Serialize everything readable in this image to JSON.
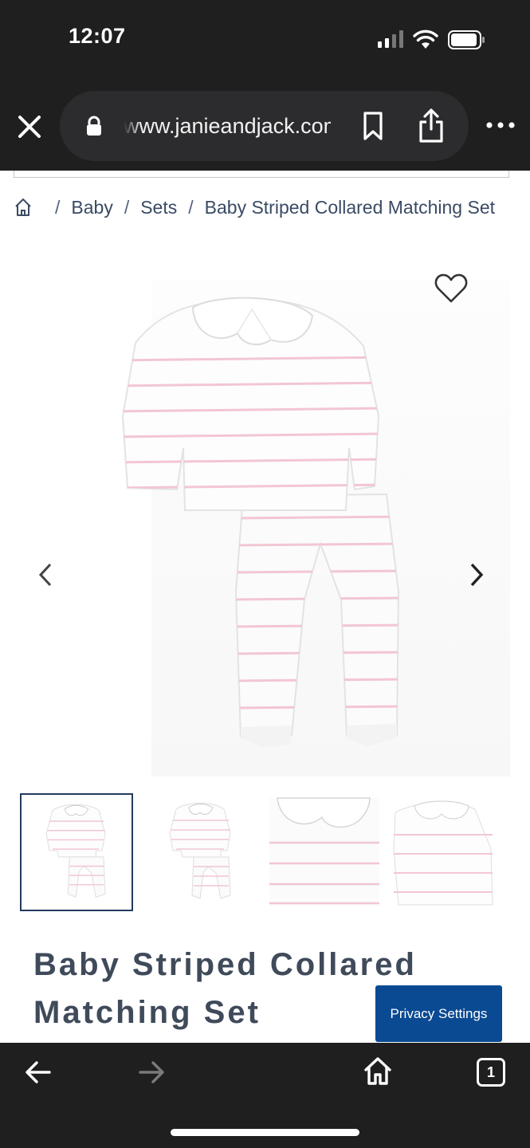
{
  "status_bar": {
    "time": "12:07",
    "icons": [
      "signal-icon",
      "wifi-icon",
      "battery-icon"
    ]
  },
  "browser": {
    "url": "www.janieandjack.com",
    "icons": [
      "close-icon",
      "lock-icon",
      "bookmark-icon",
      "share-icon",
      "more-icon"
    ]
  },
  "breadcrumb": {
    "home_icon": "home-icon",
    "items": [
      "Baby",
      "Sets",
      "Baby Striped Collared Matching Set"
    ],
    "separator": "/"
  },
  "product": {
    "title_line1": "Baby Striped Collared",
    "title_line2": "Matching Set",
    "favorite_icon": "heart-icon",
    "gallery": {
      "prev_icon": "chevron-left-icon",
      "next_icon": "chevron-right-icon",
      "thumbnails": [
        "front-view",
        "back-view",
        "collar-detail",
        "sweater-detail"
      ],
      "active_thumbnail": 1
    }
  },
  "privacy": {
    "label": "Privacy Settings",
    "color": "#0a4a93"
  },
  "bottom_nav": {
    "tab_count": "1",
    "icons": [
      "back-arrow-icon",
      "forward-arrow-icon",
      "home-icon",
      "tabs-icon"
    ]
  },
  "colors": {
    "chrome": "#1f1f1f",
    "stripe": "#f2c6d2",
    "text": "#3a4a64"
  }
}
